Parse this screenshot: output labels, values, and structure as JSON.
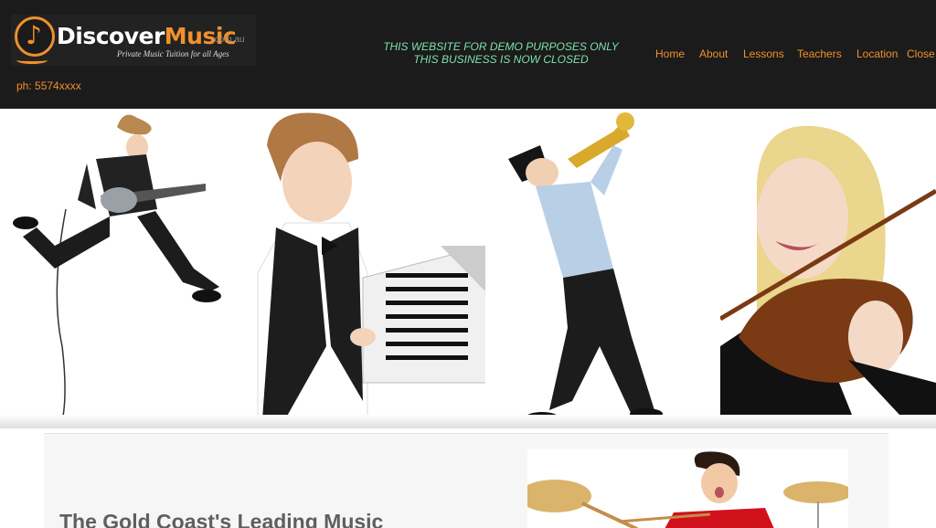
{
  "logo": {
    "word_discover": "Discover",
    "word_music": "Music",
    "domain": ".com.au",
    "tagline": "Private Music Tuition for all Ages"
  },
  "phone": "ph: 5574xxxx",
  "notice": {
    "line1": "THIS WEBSITE FOR DEMO PURPOSES ONLY",
    "line2": "THIS BUSINESS IS NOW CLOSED"
  },
  "nav": {
    "items": [
      "Home",
      "About",
      "Lessons",
      "Teachers",
      "Location",
      "Close"
    ]
  },
  "content": {
    "headline": "The Gold Coast's Leading Music"
  },
  "colors": {
    "header_bg": "#1b1b1b",
    "accent": "#f0912b",
    "notice": "#7fe0b0",
    "headline": "#5f5f5f"
  },
  "icons": {
    "logo_icon": "music-note-icon"
  }
}
